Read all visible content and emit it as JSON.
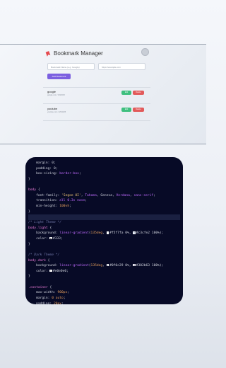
{
  "app": {
    "title": "Bookmark Manager",
    "name_placeholder": "Bookmark Name (e.g. Google)",
    "url_placeholder": "https://example.com",
    "add_button": "Add Bookmark",
    "bookmarks": [
      {
        "name": "google",
        "url": "google.com / 4/9/2025",
        "edit": "Edit",
        "delete": "Delete"
      },
      {
        "name": "youtube",
        "url": "youtube.com / 4/9/2025",
        "edit": "Edit",
        "delete": "Delete"
      }
    ]
  },
  "code": {
    "lines": [
      [
        [
          "plain",
          "    margin: 0;"
        ]
      ],
      [
        [
          "plain",
          "    padding: 0;"
        ]
      ],
      [
        [
          "plain",
          "    box-sizing: "
        ],
        [
          "val",
          "border-box"
        ],
        [
          "plain",
          ";"
        ]
      ],
      [
        [
          "plain",
          "}"
        ]
      ],
      [
        [
          "plain",
          ""
        ]
      ],
      [
        [
          "sel",
          "body"
        ],
        [
          "plain",
          " {"
        ]
      ],
      [
        [
          "plain",
          "    font-family: "
        ],
        [
          "str",
          "'Segoe UI'"
        ],
        [
          "plain",
          ", "
        ],
        [
          "val",
          "Tahoma"
        ],
        [
          "plain",
          ", Geneva, "
        ],
        [
          "val",
          "Verdana"
        ],
        [
          "plain",
          ", "
        ],
        [
          "val",
          "sans-serif"
        ],
        [
          "plain",
          ";"
        ]
      ],
      [
        [
          "plain",
          "    transition: "
        ],
        [
          "val",
          "all 0.3s ease"
        ],
        [
          "plain",
          ";"
        ]
      ],
      [
        [
          "plain",
          "    min-height: "
        ],
        [
          "num",
          "100vh"
        ],
        [
          "plain",
          ";"
        ]
      ],
      [
        [
          "plain",
          "}"
        ]
      ],
      [
        [
          "plain",
          ""
        ]
      ],
      [
        [
          "com",
          "/* Light Theme */"
        ]
      ],
      [
        [
          "sel",
          "body.light"
        ],
        [
          "plain",
          " {"
        ]
      ],
      [
        [
          "plain",
          "    background: "
        ],
        [
          "val",
          "linear-gradient"
        ],
        [
          "plain",
          "("
        ],
        [
          "num",
          "135deg"
        ],
        [
          "plain",
          ", "
        ],
        [
          "sw",
          "#f5f7fa"
        ],
        [
          "plain",
          "#f5f7fa 0%, "
        ],
        [
          "sw",
          "#c3cfe2"
        ],
        [
          "plain",
          "#c3cfe2 100%);"
        ]
      ],
      [
        [
          "plain",
          "    color: "
        ],
        [
          "sw",
          "#333333"
        ],
        [
          "plain",
          "#333;"
        ]
      ],
      [
        [
          "plain",
          "}"
        ]
      ],
      [
        [
          "plain",
          ""
        ]
      ],
      [
        [
          "com",
          "/* Dark Theme */"
        ]
      ],
      [
        [
          "sel",
          "body.dark"
        ],
        [
          "plain",
          " {"
        ]
      ],
      [
        [
          "plain",
          "    background: "
        ],
        [
          "val",
          "linear-gradient"
        ],
        [
          "plain",
          "("
        ],
        [
          "num",
          "135deg"
        ],
        [
          "plain",
          ", "
        ],
        [
          "sw",
          "#0f0c29"
        ],
        [
          "plain",
          "#0f0c29 0%, "
        ],
        [
          "sw",
          "#302b63"
        ],
        [
          "plain",
          "#302b63 100%);"
        ]
      ],
      [
        [
          "plain",
          "    color: "
        ],
        [
          "sw",
          "#e0e0e0"
        ],
        [
          "plain",
          "#e0e0e0;"
        ]
      ],
      [
        [
          "plain",
          "}"
        ]
      ],
      [
        [
          "plain",
          ""
        ]
      ],
      [
        [
          "sel",
          ".container"
        ],
        [
          "plain",
          " {"
        ]
      ],
      [
        [
          "plain",
          "    max-width: "
        ],
        [
          "num",
          "900px"
        ],
        [
          "plain",
          ";"
        ]
      ],
      [
        [
          "plain",
          "    margin: "
        ],
        [
          "num",
          "0 auto"
        ],
        [
          "plain",
          ";"
        ]
      ],
      [
        [
          "plain",
          "    padding: "
        ],
        [
          "num",
          "20px"
        ],
        [
          "plain",
          ";"
        ]
      ]
    ],
    "current_line": 10
  }
}
